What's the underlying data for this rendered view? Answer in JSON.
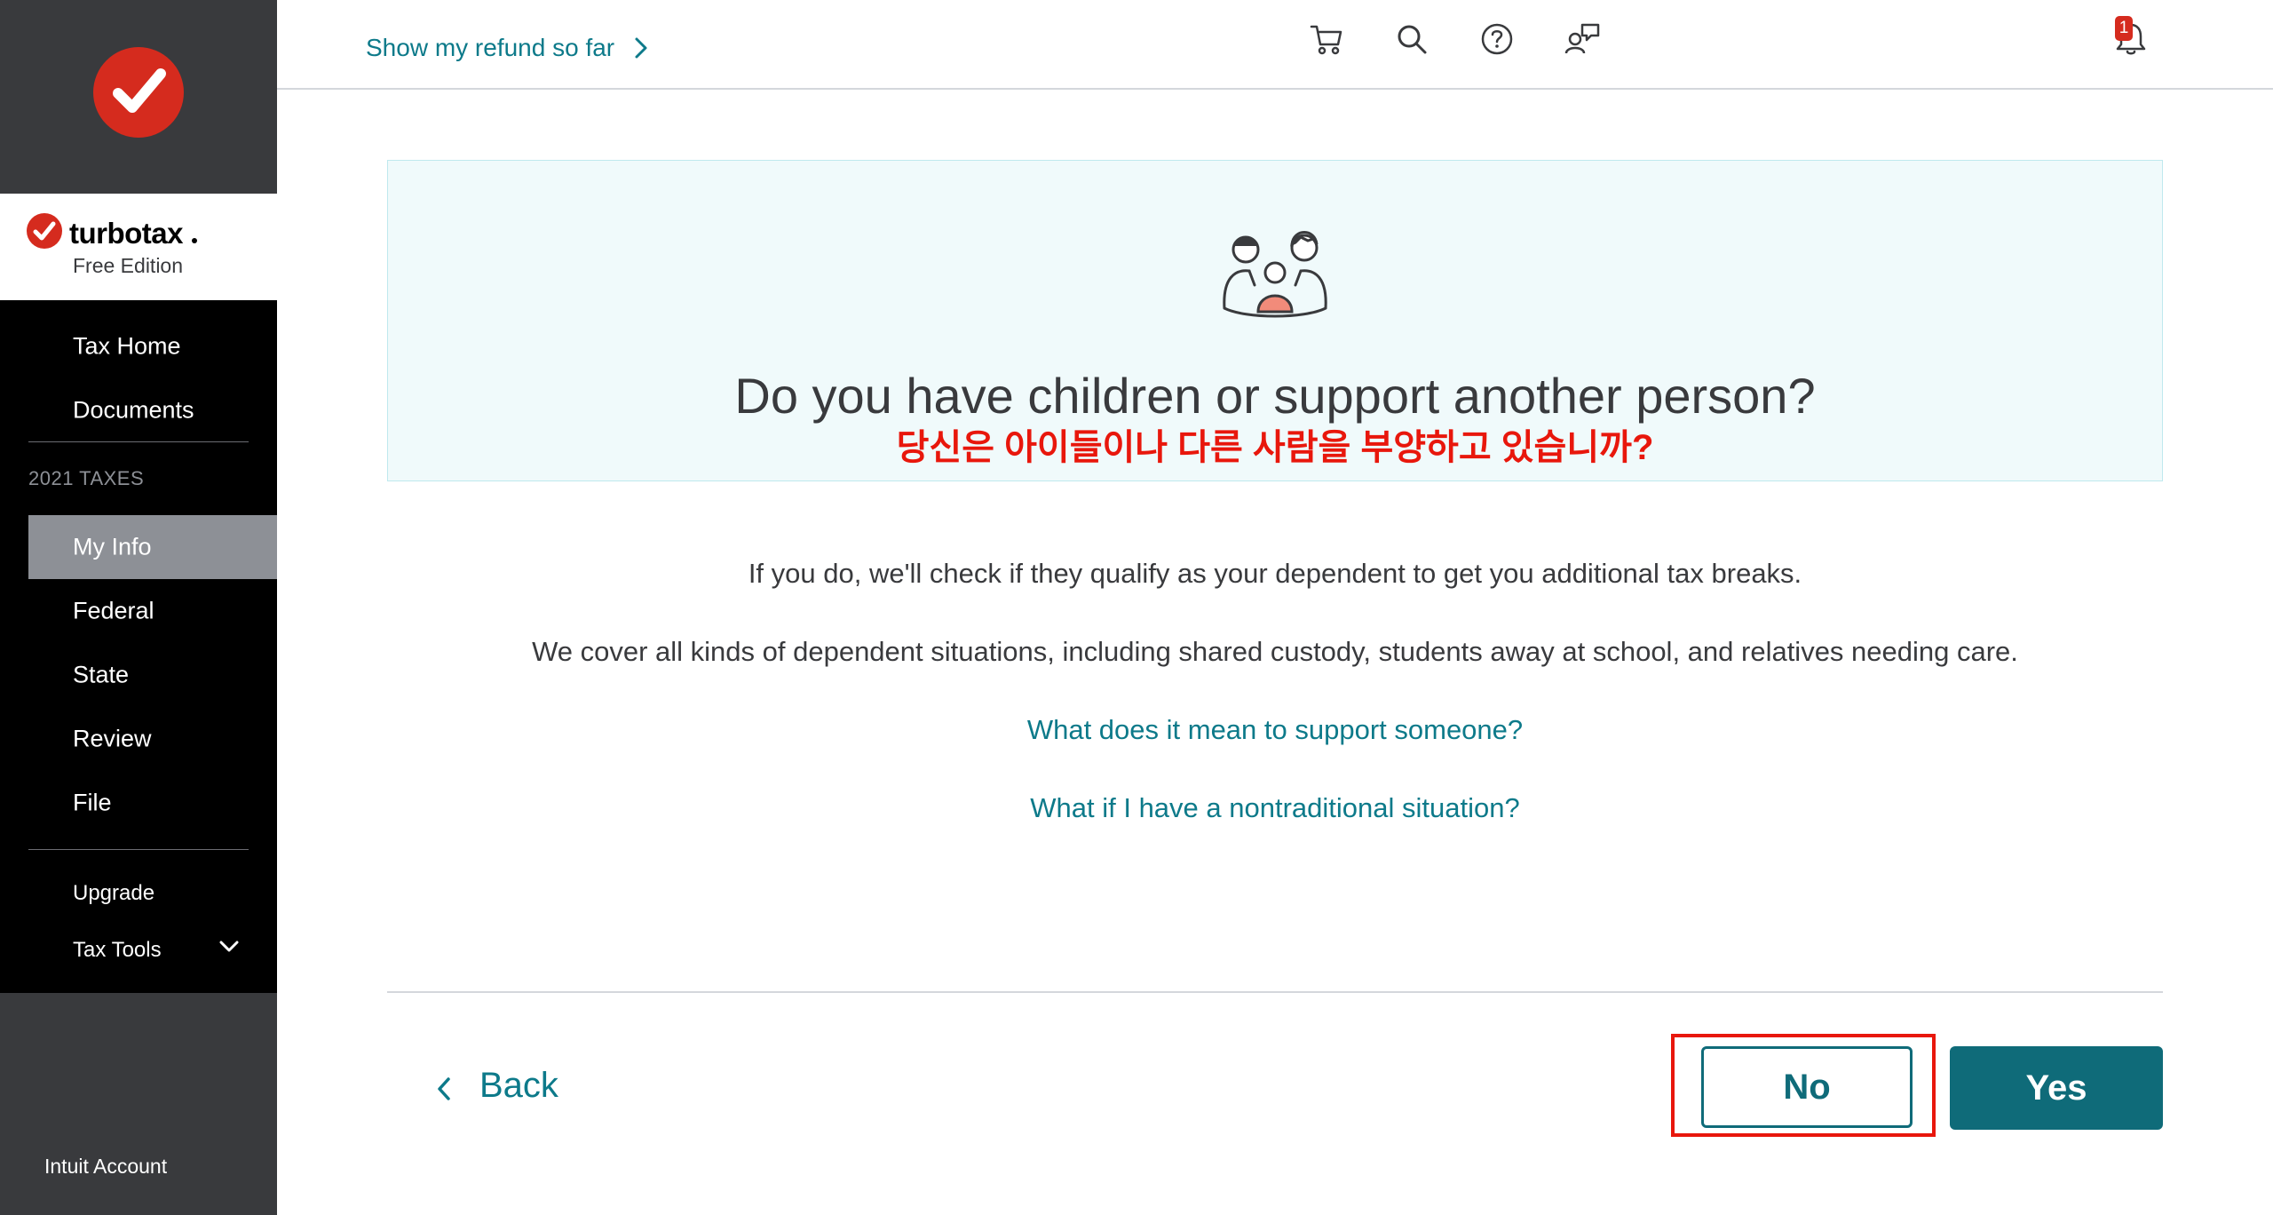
{
  "header": {
    "refund_link": "Show my refund so far",
    "notification_count": "1",
    "icons": [
      "bell-icon",
      "cart-icon",
      "search-icon",
      "help-icon",
      "chat-icon"
    ]
  },
  "sidebar": {
    "brand_name": "turbotax",
    "brand_edition": "Free Edition",
    "items_top": [
      {
        "label": "Tax Home"
      },
      {
        "label": "Documents"
      }
    ],
    "section_title": "2021 TAXES",
    "items_taxes": [
      {
        "label": "My Info",
        "active": true
      },
      {
        "label": "Federal"
      },
      {
        "label": "State"
      },
      {
        "label": "Review"
      },
      {
        "label": "File"
      }
    ],
    "upgrade": "Upgrade",
    "tax_tools": "Tax Tools",
    "intuit_account": "Intuit Account"
  },
  "question": {
    "title": "Do you have children or support another person?",
    "translation": "당신은 아이들이나 다른 사람을 부양하고 있습니까?",
    "body_1": "If you do, we'll check if they qualify as your dependent to get you additional tax breaks.",
    "body_2": "We cover all kinds of dependent situations, including shared custody, students away at school, and relatives needing care.",
    "link_1": "What does it mean to support someone?",
    "link_2": "What if I have a nontraditional situation?"
  },
  "footer": {
    "back_label": "Back",
    "no_label": "No",
    "yes_label": "Yes"
  },
  "colors": {
    "brand_red": "#d52b1e",
    "teal": "#0f6b79",
    "link_teal": "#0d7a8a",
    "sidebar_dark": "#393a3d",
    "highlight_red": "#e8170c"
  }
}
